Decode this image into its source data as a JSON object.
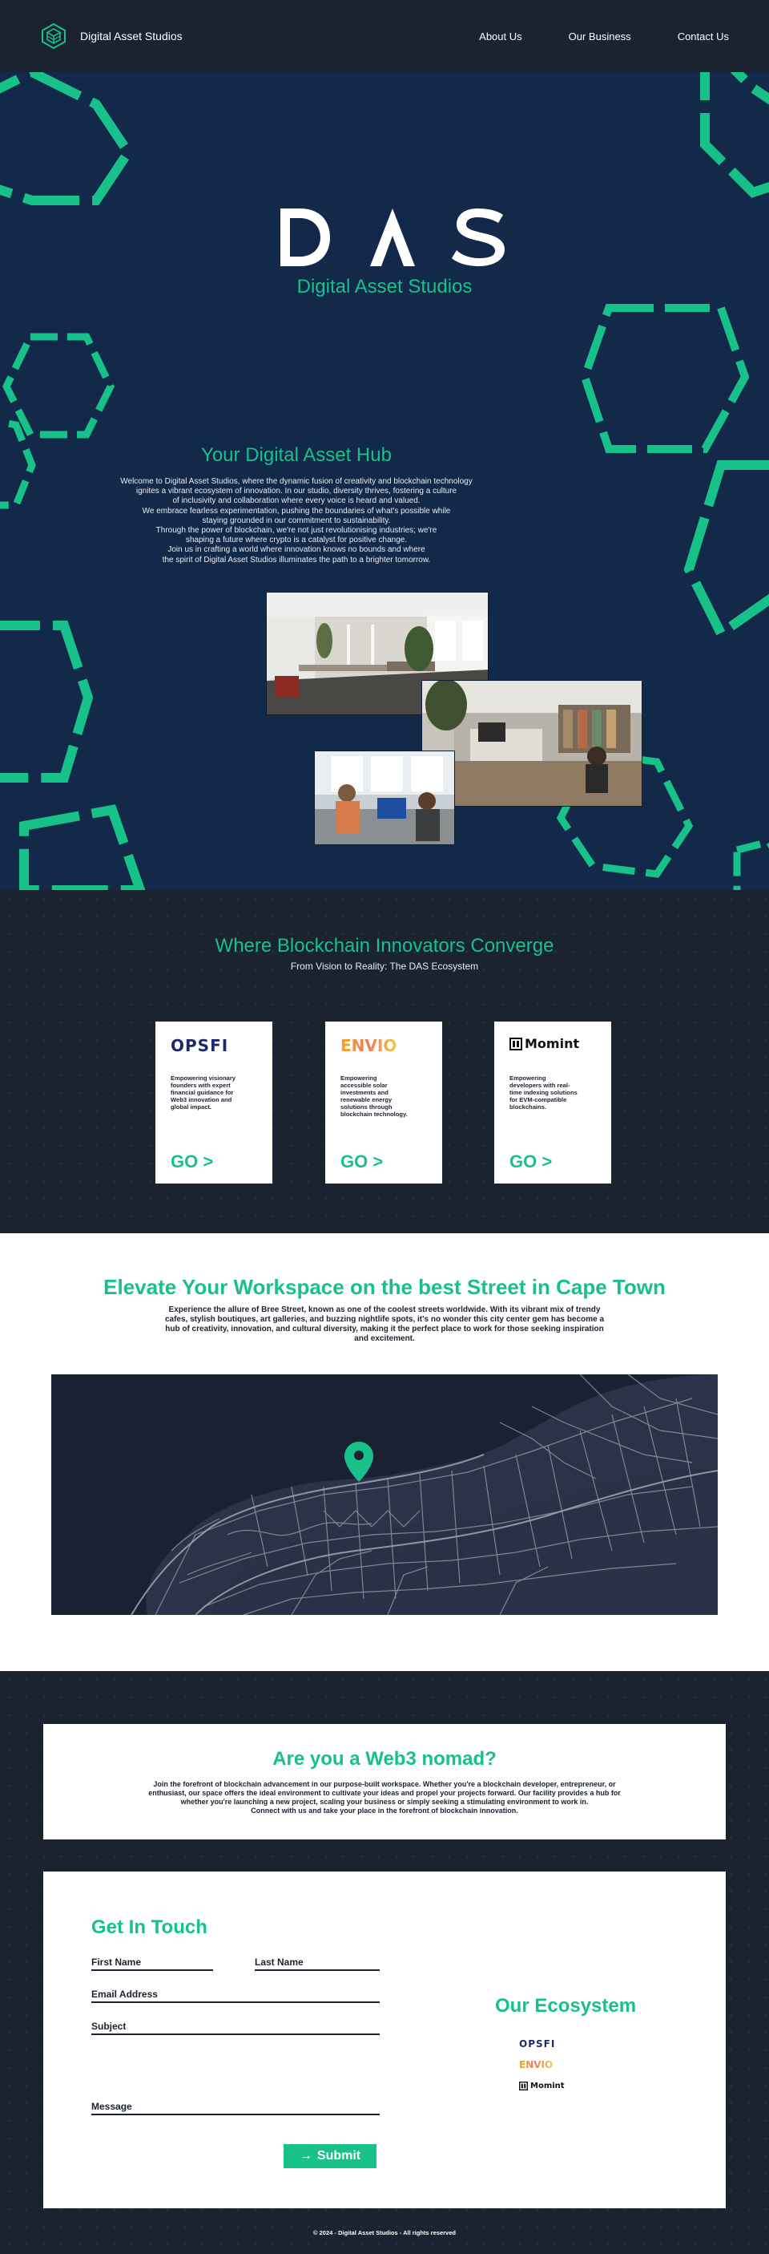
{
  "nav": {
    "brand": "Digital Asset Studios",
    "links": [
      "About Us",
      "Our Business",
      "Contact Us"
    ]
  },
  "hero": {
    "logo_text": "DAS",
    "subtitle": "Digital Asset Studios",
    "hub_title": "Your Digital Asset Hub",
    "hub_lines": [
      "Welcome to Digital Asset Studios, where the dynamic fusion of creativity and blockchain technology",
      "ignites a vibrant ecosystem of innovation. In our studio, diversity thrives, fostering a culture",
      "of inclusivity and collaboration where every voice is heard and valued.",
      "We embrace fearless experimentation, pushing the boundaries of what's possible while",
      "staying grounded in our commitment to sustainability.",
      "Through the power of blockchain, we're not just revolutionising industries; we're",
      "shaping a future where crypto is a catalyst for positive change.",
      "Join us in crafting a world where innovation knows no bounds and where",
      "the spirit of Digital Asset Studios illuminates the path to a brighter tomorrow."
    ],
    "accent": "#18c08a",
    "background": "#13294a"
  },
  "ecosystem": {
    "title": "Where Blockchain Innovators Converge",
    "subtitle": "From Vision to Reality: The DAS Ecosystem",
    "cards": [
      {
        "logo": "OPSFI",
        "desc": "Empowering visionary founders with expert financial guidance for Web3 innovation and global impact.",
        "cta": "GO >"
      },
      {
        "logo": "ENVIO",
        "desc": "Empowering accessible solar investments and renewable energy solutions through blockchain technology.",
        "cta": "GO >"
      },
      {
        "logo": "Momint",
        "desc": "Empowering developers with real-time indexing solutions for EVM-compatible blockchains.",
        "cta": "GO >"
      }
    ]
  },
  "location": {
    "title": "Elevate Your Workspace on the best Street in Cape Town",
    "text": "Experience the allure of Bree Street, known as one of the coolest streets worldwide. With its vibrant mix of trendy cafes, stylish boutiques, art galleries, and buzzing nightlife spots, it's no wonder this city center gem has become a hub of creativity, innovation, and cultural diversity, making it the perfect place to work for those seeking inspiration and excitement."
  },
  "nomad": {
    "title": "Are you a Web3 nomad?",
    "lines": [
      "Join the forefront of blockchain advancement in our purpose-built workspace. Whether you're a blockchain developer, entrepreneur, or",
      "enthusiast, our space offers the ideal environment to cultivate your ideas and propel your projects forward. Our facility provides a hub for",
      "whether you're launching a new project, scaling your business or simply seeking a stimulating environment to work in.",
      "Connect with us and take your place in the forefront of blockchain innovation."
    ]
  },
  "contact": {
    "title": "Get In Touch",
    "first_name": "First Name",
    "last_name": "Last  Name",
    "email": "Email Address",
    "subject": "Subject",
    "message": "Message",
    "submit": "Submit",
    "eco_title": "Our Ecosystem",
    "eco_items": [
      "OPSFI",
      "ENVIO",
      "Momint"
    ]
  },
  "footer": "© 2024 - Digital Asset Studios - All rights reserved"
}
